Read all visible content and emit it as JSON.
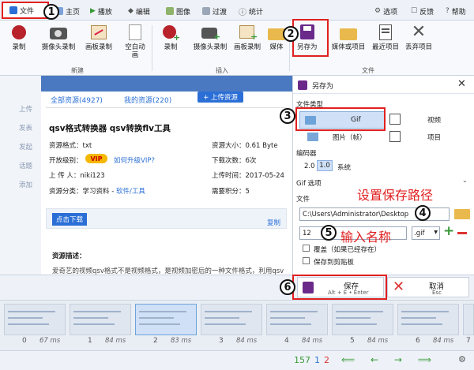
{
  "tabs": [
    {
      "label": "文件"
    },
    {
      "label": "主页"
    },
    {
      "label": "播放"
    },
    {
      "label": "编辑"
    },
    {
      "label": "图像"
    },
    {
      "label": "过渡"
    },
    {
      "label": "统计"
    }
  ],
  "window_menu": {
    "options": "选项",
    "feedback": "反馈",
    "help": "帮助"
  },
  "ribbon": {
    "new_buttons": [
      "录制",
      "摄像头录制",
      "画板录制",
      "空白动画"
    ],
    "new_group": "新建",
    "insert_buttons": [
      "录制",
      "摄像头录制",
      "画板录制",
      "媒体"
    ],
    "insert_group": "插入",
    "file_buttons": [
      "另存为",
      "媒体或项目",
      "最近项目",
      "丢弃项目"
    ],
    "file_group": "文件"
  },
  "webpage": {
    "sidebar": [
      "上传",
      "发表",
      "发起",
      "话题",
      "添加"
    ],
    "tab_all": "全部资源(4927)",
    "tab_mine": "我的资源(220)",
    "upload_btn": "+ 上传资源",
    "title": "qsv格式转换器 qsv转换flv工具",
    "format_label": "资源格式：txt",
    "size_label": "资源大小：0.61 Byte",
    "level_label": "开放级别：",
    "vip_badge": "VIP",
    "upgrade_link": "如何升级VIP?",
    "downloads_label": "下载次数：6次",
    "uploader_label": "上 传 人：niki123",
    "upload_time_label": "上传时间：2017-05-24",
    "category_label": "资源分类：学习资料 - ",
    "category_link": "软件/工具",
    "points_label": "需要积分：5",
    "download_btn": "点击下载",
    "copy_link": "复制",
    "desc_title": "资源描述：",
    "desc_text": "爱奇艺的视频qsv格式不是视频格式，是视频加密后的一种文件格式，利用qsv"
  },
  "panel": {
    "title": "另存为",
    "file_type_label": "文件类型",
    "type_gif": "Gif",
    "type_video": "视频",
    "type_image": "图片（帧）",
    "type_project": "项目",
    "encoder_label": "编码器",
    "encoder_options": [
      "2.0",
      "1.0",
      "系统"
    ],
    "gif_options_label": "Gif 选项",
    "file_label": "文件",
    "path_value": "C:\\Users\\Administrator\\Desktop",
    "name_value": "12",
    "ext_value": ".gif",
    "overwrite_label": "覆盖（如果已经存在）",
    "clipboard_label": "保存到剪贴板",
    "save_label": "保存",
    "save_shortcut": "Alt + E • Enter",
    "cancel_label": "取消",
    "cancel_shortcut": "Esc"
  },
  "filmstrip": {
    "frames": [
      {
        "num": "0",
        "ms": "67 ms"
      },
      {
        "num": "1",
        "ms": "84 ms"
      },
      {
        "num": "2",
        "ms": "83 ms"
      },
      {
        "num": "3",
        "ms": "84 ms"
      },
      {
        "num": "4",
        "ms": "84 ms"
      },
      {
        "num": "5",
        "ms": "84 ms"
      },
      {
        "num": "6",
        "ms": "84 ms"
      },
      {
        "num": "7",
        "ms": "84 ms"
      }
    ]
  },
  "status": {
    "total": "157",
    "selected": "1",
    "current": "2"
  },
  "annotations": {
    "steps": [
      "1",
      "2",
      "3",
      "4",
      "5",
      "6"
    ],
    "set_path": "设置保存路径",
    "enter_name": "输入名称"
  },
  "colors": {
    "accent": "#2b6fd6",
    "annotation": "#e02020",
    "panel_bg": "#ffffff"
  }
}
